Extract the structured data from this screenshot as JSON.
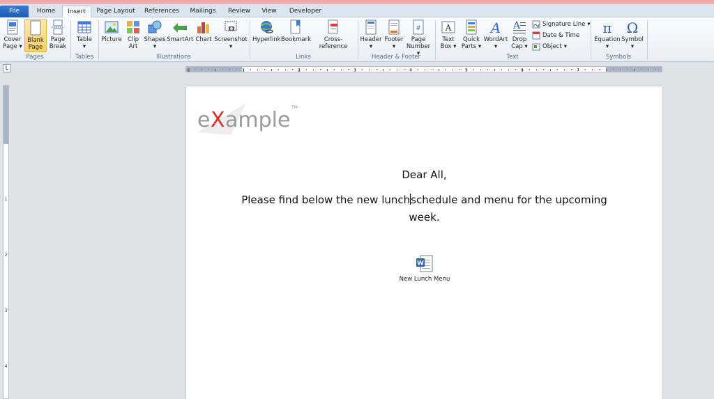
{
  "tabs": [
    "File",
    "Home",
    "Insert",
    "Page Layout",
    "References",
    "Mailings",
    "Review",
    "View",
    "Developer"
  ],
  "active_tab": "Insert",
  "ribbon": {
    "pages": {
      "label": "Pages",
      "cover_1": "Cover",
      "cover_2": "Page",
      "blank_1": "Blank",
      "blank_2": "Page",
      "break_1": "Page",
      "break_2": "Break"
    },
    "tables": {
      "label": "Tables",
      "table": "Table"
    },
    "illustrations": {
      "label": "Illustrations",
      "picture": "Picture",
      "clipart_1": "Clip",
      "clipart_2": "Art",
      "shapes": "Shapes",
      "smartart": "SmartArt",
      "chart": "Chart",
      "screenshot": "Screenshot"
    },
    "links": {
      "label": "Links",
      "hyperlink": "Hyperlink",
      "bookmark": "Bookmark",
      "crossref": "Cross-reference"
    },
    "header_footer": {
      "label": "Header & Footer",
      "header": "Header",
      "footer": "Footer",
      "pagenum_1": "Page",
      "pagenum_2": "Number"
    },
    "text": {
      "label": "Text",
      "textbox_1": "Text",
      "textbox_2": "Box",
      "quickparts_1": "Quick",
      "quickparts_2": "Parts",
      "wordart": "WordArt",
      "dropcap_1": "Drop",
      "dropcap_2": "Cap",
      "signature": "Signature Line",
      "datetime": "Date & Time",
      "object": "Object"
    },
    "symbols": {
      "label": "Symbols",
      "equation": "Equation",
      "symbol": "Symbol"
    }
  },
  "ruler": {
    "h_numbers": [
      "1",
      "1",
      "2",
      "3",
      "4",
      "5",
      "6",
      "7"
    ],
    "v_numbers": [
      "1",
      "2",
      "3",
      "4"
    ]
  },
  "document": {
    "logo_text_pre": "e",
    "logo_text_x": "X",
    "logo_text_post": "ample",
    "logo_tm": "TM",
    "greeting": "Dear All,",
    "line1_before_cursor": "Please find below the new lunch",
    "line1_after_cursor": "schedule and menu for the upcoming",
    "line2": "week.",
    "embedded_label": "New Lunch Menu"
  },
  "colors": {
    "file_tab": "#2a6ac4",
    "accent": "#2b579a",
    "logo_x": "#d9322b",
    "logo_grey": "#9a9a9a"
  }
}
